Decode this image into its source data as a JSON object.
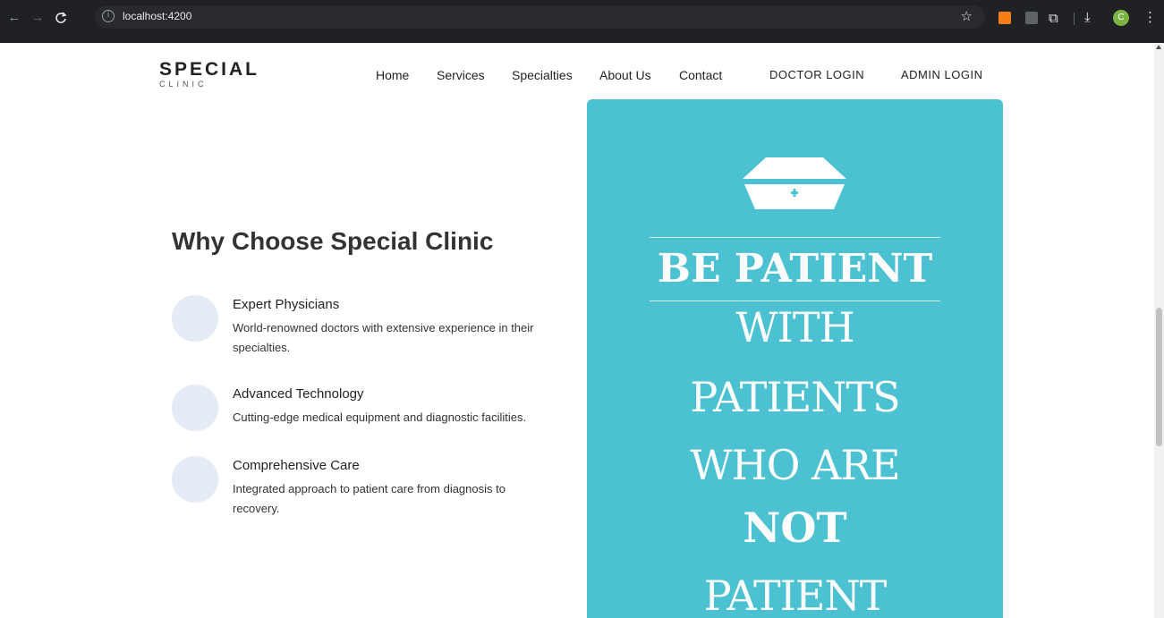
{
  "browser": {
    "url": "localhost:4200",
    "profile_initial": "C",
    "icons": [
      "back-icon",
      "forward-icon",
      "reload-icon",
      "info-icon",
      "star-icon",
      "extension-icon",
      "puzzle-icon",
      "download-icon",
      "menu-icon"
    ]
  },
  "brand": {
    "name": "SPECIAL",
    "subtitle": "CLINIC"
  },
  "nav": {
    "items": [
      "Home",
      "Services",
      "Specialties",
      "About Us",
      "Contact"
    ],
    "doctor_login": "DOCTOR LOGIN",
    "admin_login": "ADMIN LOGIN"
  },
  "why": {
    "title": "Why Choose Special Clinic",
    "features": [
      {
        "title": "Expert Physicians",
        "desc": "World-renowned doctors with extensive experience in their specialties."
      },
      {
        "title": "Advanced Technology",
        "desc": "Cutting-edge medical equipment and diagnostic facilities."
      },
      {
        "title": "Comprehensive Care",
        "desc": "Integrated approach to patient care from diagnosis to recovery."
      }
    ]
  },
  "poster": {
    "background": "#4bc1d2",
    "icon": "nurse-cap-icon",
    "lines": [
      "BE PATIENT",
      "WITH",
      "PATIENTS",
      "WHO ARE",
      "NOT",
      "PATIENT"
    ]
  }
}
